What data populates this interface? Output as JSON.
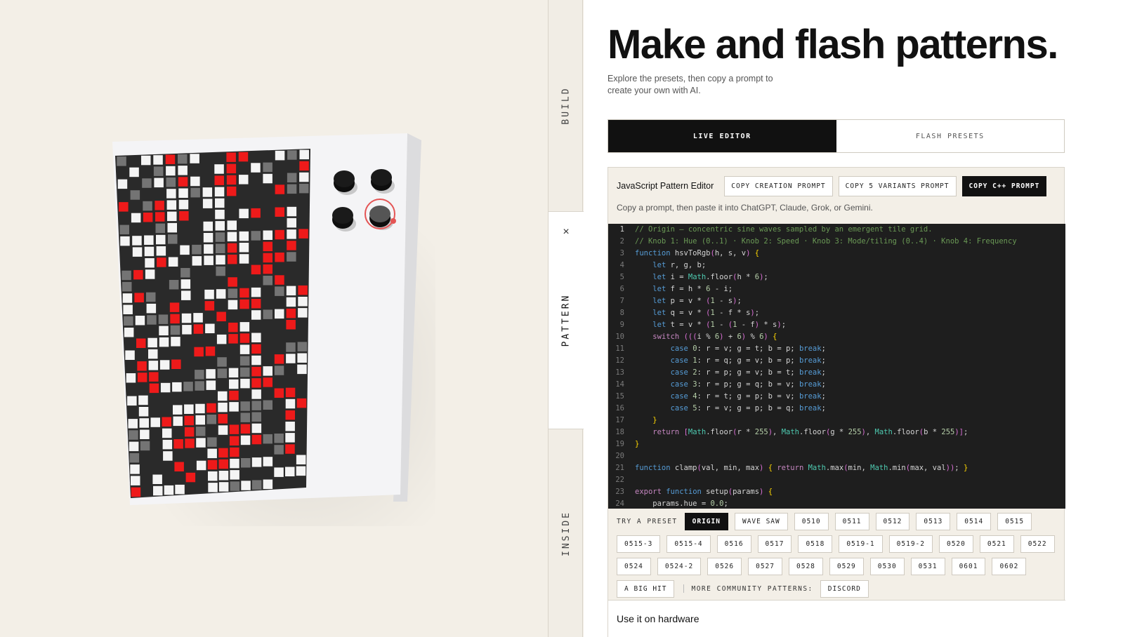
{
  "nav": {
    "tabs": [
      "BUILD",
      "PATTERN",
      "INSIDE"
    ],
    "close_icon": "×"
  },
  "header": {
    "title": "Make and flash patterns.",
    "subtitle": "Explore the presets, then copy a prompt to create your own with AI."
  },
  "mode_tabs": [
    "LIVE EDITOR",
    "FLASH PRESETS"
  ],
  "editor": {
    "title": "JavaScript Pattern Editor",
    "buttons": [
      "COPY CREATION PROMPT",
      "COPY 5 VARIANTS PROMPT",
      "COPY C++ PROMPT"
    ],
    "hint": "Copy a prompt, then paste it into ChatGPT, Claude, Grok, or Gemini.",
    "code_lines": [
      "// Origin — concentric sine waves sampled by an emergent tile grid.",
      "// Knob 1: Hue (0..1) · Knob 2: Speed · Knob 3: Mode/tiling (0..4) · Knob 4: Frequency",
      "function hsvToRgb(h, s, v) {",
      "    let r, g, b;",
      "    let i = Math.floor(h * 6);",
      "    let f = h * 6 - i;",
      "    let p = v * (1 - s);",
      "    let q = v * (1 - f * s);",
      "    let t = v * (1 - (1 - f) * s);",
      "    switch (((i % 6) + 6) % 6) {",
      "        case 0: r = v; g = t; b = p; break;",
      "        case 1: r = q; g = v; b = p; break;",
      "        case 2: r = p; g = v; b = t; break;",
      "        case 3: r = p; g = q; b = v; break;",
      "        case 4: r = t; g = p; b = v; break;",
      "        case 5: r = v; g = p; b = q; break;",
      "    }",
      "    return [Math.floor(r * 255), Math.floor(g * 255), Math.floor(b * 255)];",
      "}",
      "",
      "function clamp(val, min, max) { return Math.max(min, Math.min(max, val)); }",
      "",
      "export function setup(params) {",
      "    params.hue = 0.0;"
    ]
  },
  "presets": {
    "label": "TRY A PRESET",
    "active": "ORIGIN",
    "rows": [
      [
        "ORIGIN",
        "WAVE SAW",
        "0510",
        "0511",
        "0512",
        "0513",
        "0514",
        "0515"
      ],
      [
        "0515-3",
        "0515-4",
        "0516",
        "0517",
        "0518",
        "0519-1",
        "0519-2",
        "0520",
        "0521",
        "0522"
      ],
      [
        "0524",
        "0524-2",
        "0526",
        "0527",
        "0528",
        "0529",
        "0530",
        "0531",
        "0601",
        "0602"
      ]
    ],
    "last_row": {
      "item": "A BIG HIT",
      "community_label": "MORE COMMUNITY PATTERNS:",
      "discord": "DISCORD"
    }
  },
  "hardware": {
    "title": "Use it on hardware"
  },
  "colors": {
    "accent_red": "#ee1a1a",
    "panel_bg": "#f3efe7",
    "dark": "#111111",
    "code_bg": "#1e1e1e",
    "code_comment": "#6a9955",
    "code_keyword": "#569cd6",
    "code_type": "#4ec9b0",
    "code_number": "#b5cea8",
    "code_control": "#c586c0"
  },
  "icons": {
    "close": "close-icon",
    "knob": "knob-icon"
  }
}
